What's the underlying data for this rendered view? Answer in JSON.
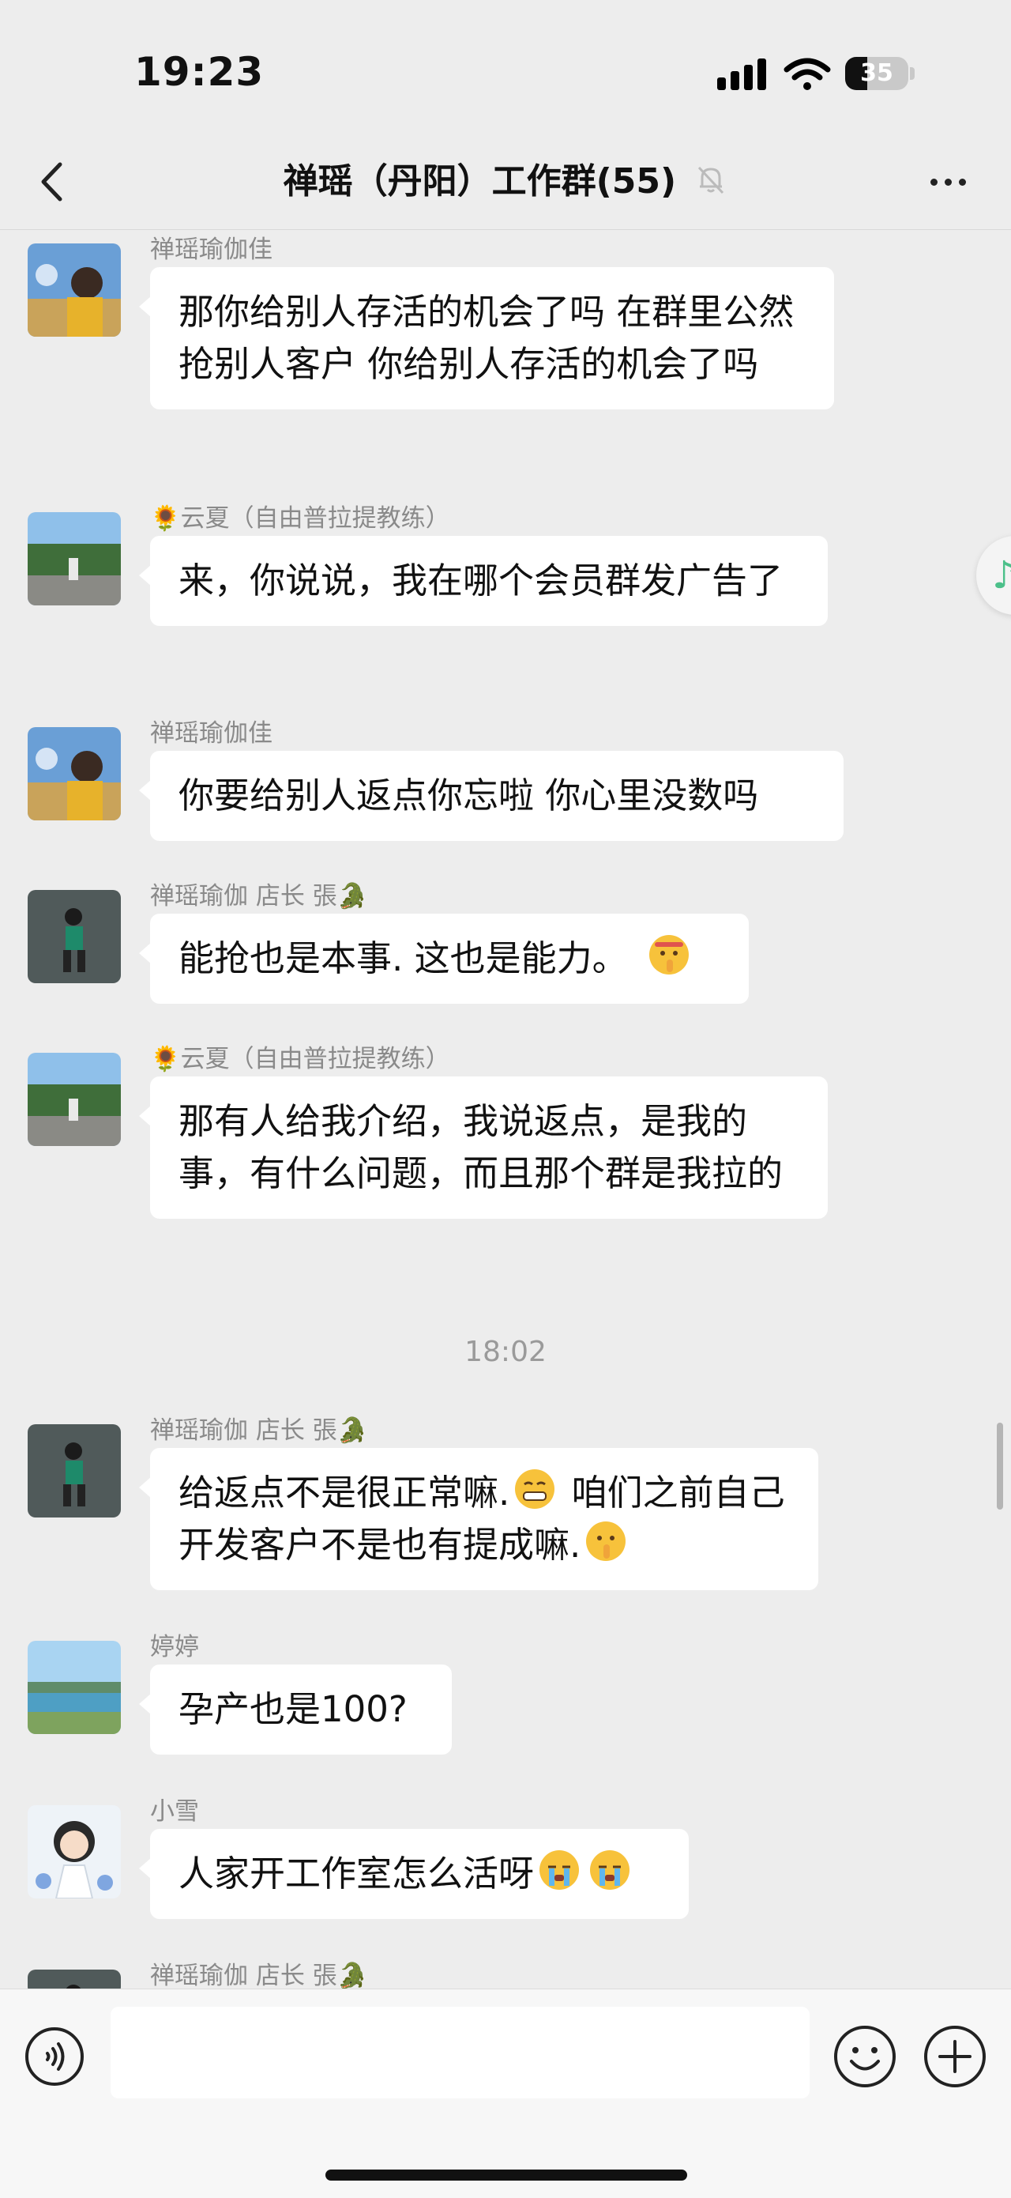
{
  "status_bar": {
    "time": "19:23",
    "battery": "35"
  },
  "nav": {
    "title": "禅瑶（丹阳）工作群(55)",
    "muted": true
  },
  "messages": [
    {
      "sender": "禅瑶瑜伽佳",
      "text": "那你给别人存活的机会了吗 在群里公然抢别人客户 你给别人存活的机会了吗",
      "avatar": "avatar-photo-girl"
    },
    {
      "sender": "🌻云夏（自由普拉提教练）",
      "text": "来，你说说，我在哪个会员群发广告了",
      "avatar": "avatar-photo-landscape"
    },
    {
      "sender": "禅瑶瑜伽佳",
      "text": "你要给别人返点你忘啦 你心里没数吗",
      "avatar": "avatar-photo-girl"
    },
    {
      "sender": "禅瑶瑜伽  店长 張🐊",
      "text": "能抢也是本事. 这也是能力。",
      "emoji": "shushing-face",
      "avatar": "avatar-photo-dark"
    },
    {
      "sender": "🌻云夏（自由普拉提教练）",
      "text": "那有人给我介绍，我说返点，是我的事，有什么问题，而且那个群是我拉的",
      "avatar": "avatar-photo-landscape"
    },
    {
      "sender": "禅瑶瑜伽  店长 張🐊",
      "text_a": "给返点不是很正常嘛.",
      "text_b": " 咱们之前自己开发客户不是也有提成嘛.",
      "avatar": "avatar-photo-dark"
    },
    {
      "sender": "婷婷",
      "text": "孕产也是100?",
      "avatar": "avatar-photo-lake"
    },
    {
      "sender": "小雪",
      "text": "人家开工作室怎么活呀",
      "avatar": "avatar-cartoon-girl"
    },
    {
      "sender": "禅瑶瑜伽  店长 張🐊",
      "avatar": "avatar-photo-dark"
    }
  ],
  "time_divider": "18:02",
  "colors": {
    "background": "#ededed",
    "bubble": "#ffffff",
    "accent_music": "#4cc08a"
  }
}
